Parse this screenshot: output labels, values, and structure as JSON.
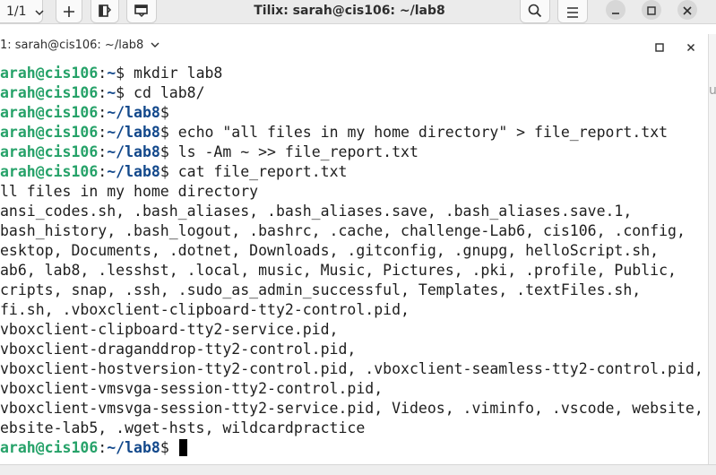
{
  "header": {
    "session_label": "1/1",
    "title": "Tilix: sarah@cis106: ~/lab8",
    "icons": [
      "chevron-down-icon",
      "plus-icon",
      "split-right-icon",
      "split-down-icon",
      "search-icon",
      "hamburger-menu-icon",
      "minimize-icon",
      "maximize-icon",
      "close-icon"
    ]
  },
  "terminal_bar": {
    "title": "1: sarah@cis106: ~/lab8",
    "icons": [
      "chevron-down-icon",
      "maximize-icon",
      "close-icon"
    ]
  },
  "right_peek": "u",
  "colors": {
    "prompt_user": "#26a269",
    "prompt_path": "#12488b",
    "text": "#1e1e1e",
    "cursor": "#000000"
  },
  "terminal": {
    "line_1": {
      "user": "arah@cis106",
      "colon": ":",
      "path": "~",
      "dollar": "$",
      "cmd": " mkdir lab8"
    },
    "line_2": {
      "user": "arah@cis106",
      "colon": ":",
      "path": "~",
      "dollar": "$",
      "cmd": " cd lab8/"
    },
    "line_3": {
      "user": "arah@cis106",
      "colon": ":",
      "path": "~/lab8",
      "dollar": "$",
      "cmd": ""
    },
    "line_4": {
      "user": "arah@cis106",
      "colon": ":",
      "path": "~/lab8",
      "dollar": "$",
      "cmd": " echo \"all files in my home directory\" > file_report.txt"
    },
    "line_5": {
      "user": "arah@cis106",
      "colon": ":",
      "path": "~/lab8",
      "dollar": "$",
      "cmd": " ls -Am ~ >> file_report.txt"
    },
    "line_6": {
      "user": "arah@cis106",
      "colon": ":",
      "path": "~/lab8",
      "dollar": "$",
      "cmd": " cat file_report.txt"
    },
    "out_1": "ll files in my home directory",
    "out_2": "ansi_codes.sh, .bash_aliases, .bash_aliases.save, .bash_aliases.save.1,",
    "out_3": "bash_history, .bash_logout, .bashrc, .cache, challenge-Lab6, cis106, .config,",
    "out_4": "esktop, Documents, .dotnet, Downloads, .gitconfig, .gnupg, helloScript.sh,",
    "out_5": "ab6, lab8, .lesshst, .local, music, Music, Pictures, .pki, .profile, Public,",
    "out_6": "cripts, snap, .ssh, .sudo_as_admin_successful, Templates, .textFiles.sh,",
    "out_7": "fi.sh, .vboxclient-clipboard-tty2-control.pid,",
    "out_8": "vboxclient-clipboard-tty2-service.pid,",
    "out_9": "vboxclient-draganddrop-tty2-control.pid,",
    "out_10": "vboxclient-hostversion-tty2-control.pid, .vboxclient-seamless-tty2-control.pid,",
    "out_11": "vboxclient-vmsvga-session-tty2-control.pid,",
    "out_12": "vboxclient-vmsvga-session-tty2-service.pid, Videos, .viminfo, .vscode, website,",
    "out_13": "ebsite-lab5, .wget-hsts, wildcardpractice",
    "line_final": {
      "user": "arah@cis106",
      "colon": ":",
      "path": "~/lab8",
      "dollar": "$",
      "cmd": " "
    }
  }
}
